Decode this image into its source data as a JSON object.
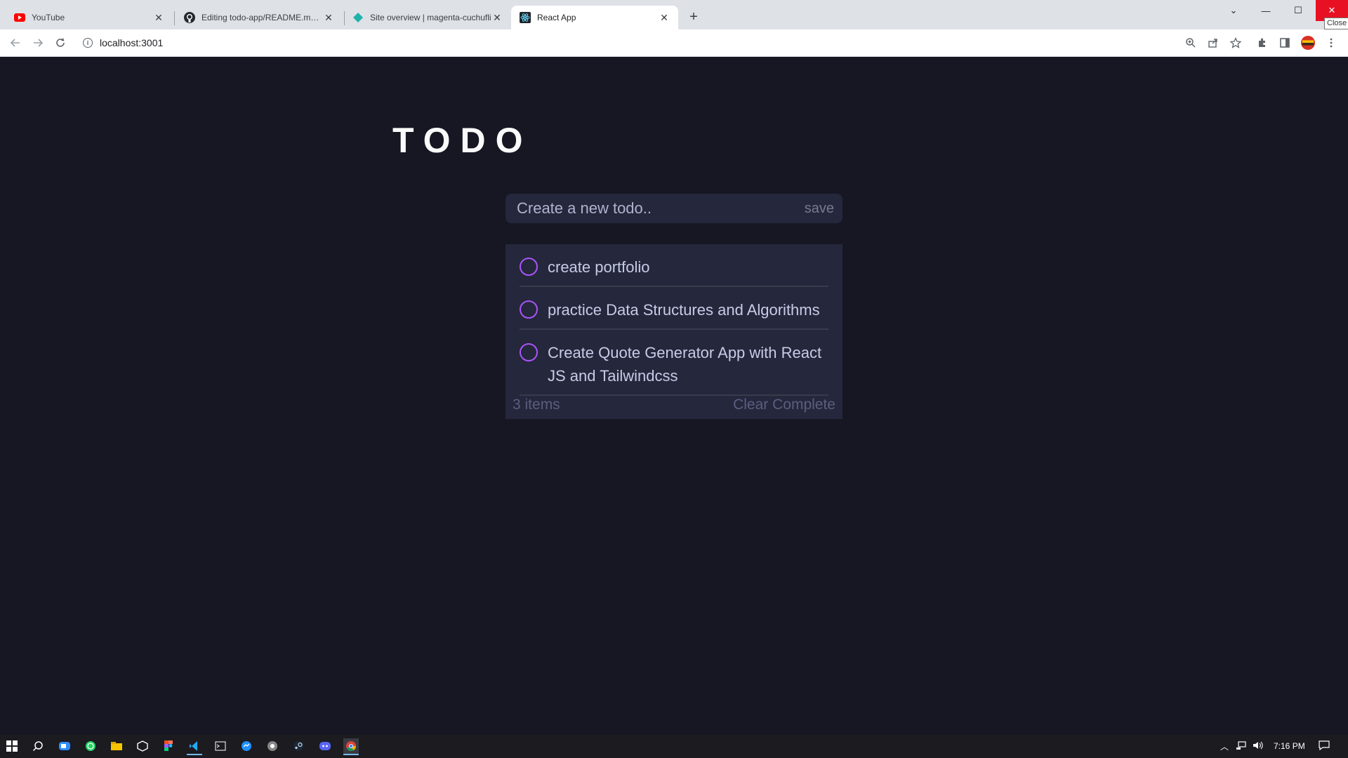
{
  "browser": {
    "tabs": [
      {
        "title": "YouTube",
        "icon": "youtube-icon",
        "active": false
      },
      {
        "title": "Editing todo-app/README.md at",
        "icon": "github-icon",
        "active": false
      },
      {
        "title": "Site overview | magenta-cuchufli",
        "icon": "netlify-icon",
        "active": false
      },
      {
        "title": "React App",
        "icon": "react-icon",
        "active": true
      }
    ],
    "url": "localhost:3001",
    "close_tooltip": "Close"
  },
  "app": {
    "title": "TODO",
    "new_todo": {
      "placeholder": "Create a new todo..",
      "value": "",
      "save_label": "save"
    },
    "todos": [
      {
        "text": "create portfolio",
        "completed": false
      },
      {
        "text": "practice Data Structures and Algorithms",
        "completed": false
      },
      {
        "text": "Create Quote Generator App with ReactJS and Tailwindcss",
        "completed": false
      }
    ],
    "footer": {
      "count_label": "3 items",
      "clear_label": "Clear Complete"
    },
    "colors": {
      "background": "#171724",
      "card": "#25273c",
      "accent": "#a855f7",
      "text": "#c8cbe7",
      "muted": "#5b5e7e"
    }
  },
  "taskbar": {
    "time": "7:16 PM"
  }
}
